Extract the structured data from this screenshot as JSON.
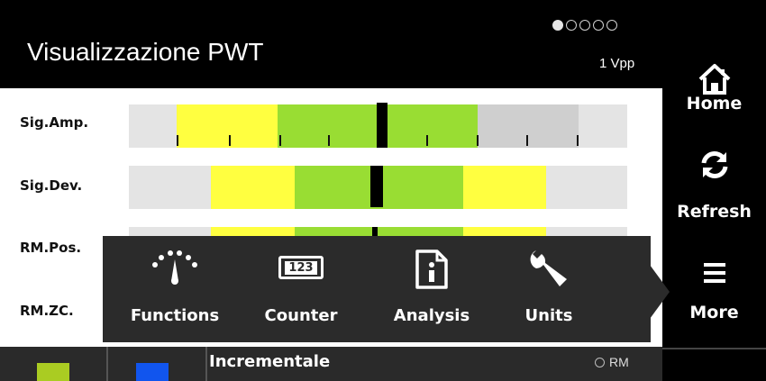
{
  "header": {
    "title": "Visualizzazione PWT",
    "signal_type": "1 Vpp",
    "page_dots": {
      "total": 5,
      "active": 1
    }
  },
  "sidebar": {
    "home_label": "Home",
    "refresh_label": "Refresh",
    "more_label": "More"
  },
  "rows": [
    {
      "label": "Sig.Amp."
    },
    {
      "label": "Sig.Dev."
    },
    {
      "label": "RM.Pos."
    },
    {
      "label": "RM.ZC."
    }
  ],
  "more_menu": {
    "functions_label": "Functions",
    "counter_label": "Counter",
    "counter_icon_text": "123",
    "analysis_label": "Analysis",
    "units_label": "Units"
  },
  "bottom_bar": {
    "mode_label": "Incrementale",
    "rm_label": "RM"
  },
  "colors": {
    "yellow": "#ffff40",
    "green": "#99dd33",
    "gray": "#cfcfcf",
    "track": "#e4e4e4",
    "bottom_green": "#aacc22",
    "bottom_blue": "#1155ee"
  },
  "icons": [
    "home-icon",
    "refresh-icon",
    "menu-icon",
    "gauge-icon",
    "counter-icon",
    "info-document-icon",
    "wrench-icon"
  ]
}
